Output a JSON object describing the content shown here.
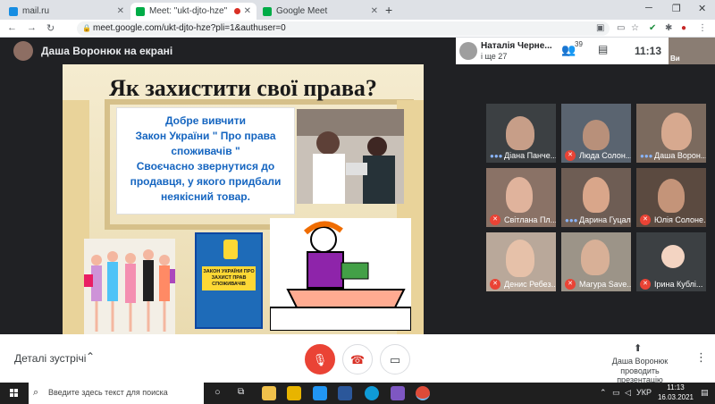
{
  "browser": {
    "tabs": [
      {
        "title": "mail.ru"
      },
      {
        "title": "Meet: \"ukt-djto-hze\""
      },
      {
        "title": "Google Meet"
      }
    ],
    "url": "meet.google.com/ukt-djto-hze?pli=1&authuser=0"
  },
  "meet": {
    "presenter_banner": "Даша Воронюк на екрані",
    "top_participant": {
      "name": "Наталія Черне...",
      "more": "і ще 27"
    },
    "people_count": "39",
    "clock": "11:13",
    "self_label": "Ви",
    "participants": [
      {
        "name": "Діана Панче...",
        "mic": "speaking"
      },
      {
        "name": "Люда Солон...",
        "mic": "muted"
      },
      {
        "name": "Даша Ворон...",
        "mic": "speaking"
      },
      {
        "name": "Світлана Пл...",
        "mic": "muted"
      },
      {
        "name": "Дарина Гуцал",
        "mic": "speaking"
      },
      {
        "name": "Юлія Солоне...",
        "mic": "muted"
      },
      {
        "name": "Денис Ребез...",
        "mic": "muted"
      },
      {
        "name": "Магура Save...",
        "mic": "muted"
      },
      {
        "name": "Ірина Кублі...",
        "mic": "muted"
      }
    ],
    "details_label": "Деталі зустрічі",
    "presenting_line1": "Даша Воронюк",
    "presenting_line2": "проводить презентацію"
  },
  "slide": {
    "title": "Як захистити свої права?",
    "lines": [
      "Добре вивчити",
      "Закон України \" Про права",
      "споживачів \"",
      "Своєчасно звернутися до",
      "продавця, у якого придбали",
      "неякісний товар."
    ],
    "book_label": "ЗАКОН УКРАЇНИ ПРО ЗАХИСТ ПРАВ СПОЖИВАЧІВ"
  },
  "taskbar": {
    "search_placeholder": "Введите здесь текст для поиска",
    "lang": "УКР",
    "time": "11:13",
    "date": "16.03.2021"
  }
}
